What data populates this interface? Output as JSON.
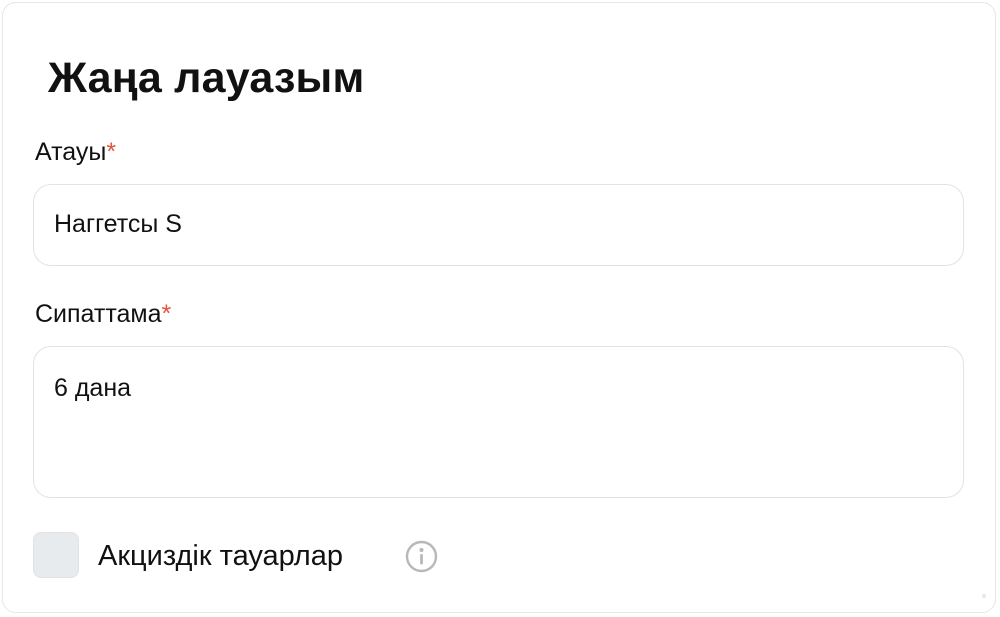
{
  "form": {
    "title": "Жаңа лауазым",
    "required_marker": "*",
    "name_field": {
      "label": "Атауы",
      "value": "Наггетсы S"
    },
    "description_field": {
      "label": "Сипаттама",
      "value": "6 дана"
    },
    "excise_checkbox": {
      "label": "Акциздік тауарлар",
      "checked": false
    }
  },
  "icons": {
    "info": "info-icon"
  },
  "colors": {
    "required_accent": "#e5533f",
    "checkbox_fill": "#e8ebee",
    "border": "#e3e3e3",
    "info_icon": "#b8b8b8"
  }
}
